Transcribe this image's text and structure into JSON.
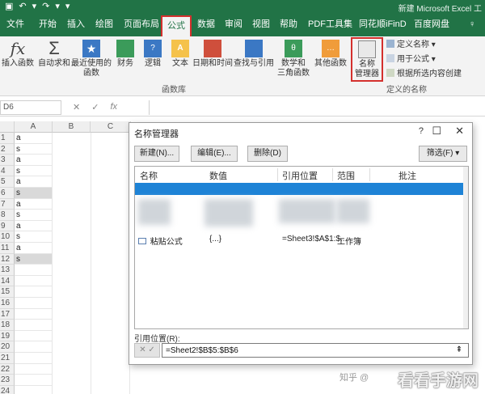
{
  "window": {
    "title": "新建 Microsoft Excel 工"
  },
  "qat": {
    "save": "▣",
    "undo": "↶",
    "undo_dd": "▾",
    "redo": "↷",
    "redo_dd": "▾",
    "more": "▾"
  },
  "tabs": [
    "文件",
    "开始",
    "插入",
    "绘图",
    "页面布局",
    "公式",
    "数据",
    "审阅",
    "视图",
    "帮助",
    "PDF工具集",
    "同花顺iFinD",
    "百度网盘",
    "♀"
  ],
  "active_tab": "公式",
  "ribbon": {
    "insert_function": "插入函数",
    "autosum": "自动求和",
    "recent": [
      "最近使用的",
      "函数"
    ],
    "finance": "财务",
    "logic": "逻辑",
    "text": "文本",
    "datetime": "日期和时间",
    "lookup": "查找与引用",
    "math": [
      "数学和",
      "三角函数"
    ],
    "other": "其他函数",
    "group_library": "函数库",
    "name_manager": [
      "名称",
      "管理器"
    ],
    "define_name": "定义名称",
    "use_in_formula": "用于公式",
    "create_from_selection": "根据所选内容创建",
    "group_names": "定义的名称"
  },
  "formula_bar": {
    "name_box": "D6",
    "cancel": "✕",
    "enter": "✓",
    "fx": "fx"
  },
  "columns": [
    "A",
    "B",
    "C"
  ],
  "rows": [
    {
      "num": "1",
      "a": "a"
    },
    {
      "num": "2",
      "a": "s"
    },
    {
      "num": "3",
      "a": "a"
    },
    {
      "num": "4",
      "a": "s"
    },
    {
      "num": "5",
      "a": "a"
    },
    {
      "num": "6",
      "a": "s"
    },
    {
      "num": "7",
      "a": "a"
    },
    {
      "num": "8",
      "a": "s"
    },
    {
      "num": "9",
      "a": "a"
    },
    {
      "num": "10",
      "a": "s"
    },
    {
      "num": "11",
      "a": "a"
    },
    {
      "num": "12",
      "a": "s"
    },
    {
      "num": "13",
      "a": ""
    },
    {
      "num": "14",
      "a": ""
    },
    {
      "num": "15",
      "a": ""
    },
    {
      "num": "16",
      "a": ""
    },
    {
      "num": "17",
      "a": ""
    },
    {
      "num": "18",
      "a": ""
    },
    {
      "num": "19",
      "a": ""
    },
    {
      "num": "20",
      "a": ""
    },
    {
      "num": "21",
      "a": ""
    },
    {
      "num": "22",
      "a": ""
    },
    {
      "num": "23",
      "a": ""
    },
    {
      "num": "24",
      "a": ""
    }
  ],
  "dialog": {
    "title": "名称管理器",
    "minimize": "?",
    "maximize": "☐",
    "close": "✕",
    "new": "新建(N)...",
    "edit": "编辑(E)...",
    "delete": "删除(D)",
    "filter": "筛选(F) ▾",
    "headers": [
      "名称",
      "数值",
      "引用位置",
      "范围",
      "批注"
    ],
    "row_visible": {
      "name": "粘贴公式",
      "value": "{...}",
      "ref": "=Sheet3!$A$1:$...",
      "scope": "工作簿"
    },
    "ref_label": "引用位置(R):",
    "ref_value": "=Sheet2!$B$5:$B$6",
    "ref_icons": "✕ ✓",
    "ref_button": "⇞"
  },
  "watermark": "看看手游网",
  "zhihu": "知乎 @"
}
